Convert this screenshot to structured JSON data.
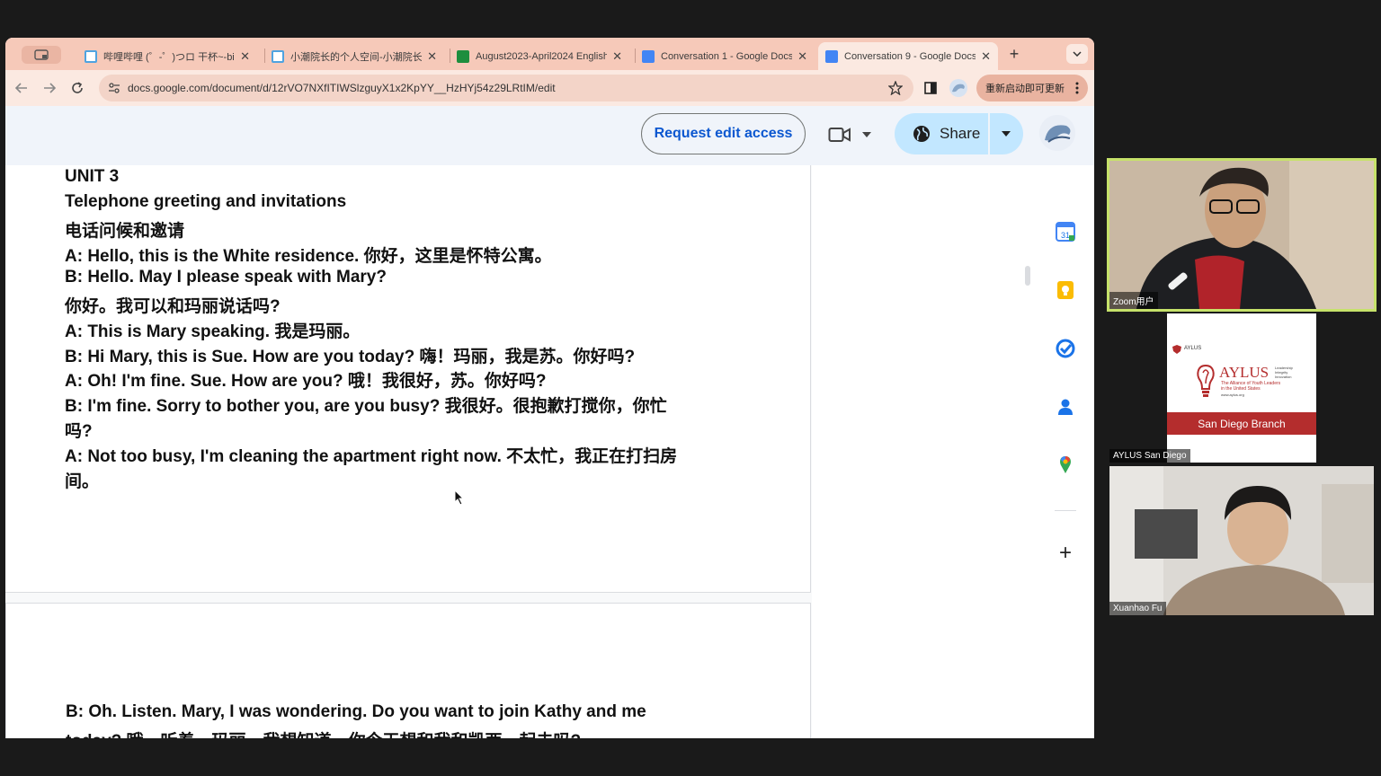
{
  "browser": {
    "tabs": [
      {
        "title": "哔哩哔哩 (゜-゜)つロ 干杯~-bi",
        "favicon_color": "#4fa3e0"
      },
      {
        "title": "小潮院长的个人空间-小潮院长",
        "favicon_color": "#4fa3e0"
      },
      {
        "title": "August2023-April2024 English",
        "favicon_color": "#1e8e3e"
      },
      {
        "title": "Conversation 1 - Google Docs",
        "favicon_color": "#4285f4"
      },
      {
        "title": "Conversation 9 - Google Docs",
        "favicon_color": "#4285f4"
      }
    ],
    "new_tab_symbol": "+",
    "close_symbol": "✕",
    "url": "docs.google.com/document/d/12rVO7NXfITIWSlzguyX1x2KpYY__HzHYj54z29LRtIM/edit",
    "relaunch_label": "重新启动即可更新"
  },
  "docs": {
    "request_edit_label": "Request edit access",
    "share_label": "Share",
    "page1_lines": [
      "UNIT 3",
      "Telephone greeting and invitations",
      "电话问候和邀请",
      "A: Hello, this is the White residence. 你好，这里是怀特公寓。",
      "B: Hello. May I please speak with Mary?",
      "你好。我可以和玛丽说话吗?",
      "A: This is Mary speaking. 我是玛丽。",
      "B: Hi Mary, this is Sue. How are you today? 嗨！玛丽，我是苏。你好吗?",
      "A: Oh! I'm fine. Sue. How are you? 哦！我很好，苏。你好吗?",
      "B: I'm fine. Sorry to bother you, are you busy? 我很好。很抱歉打搅你，你忙",
      "吗?",
      "A: Not too busy, I'm cleaning the apartment right now. 不太忙，我正在打扫房",
      "间。"
    ],
    "page2_lines": [
      "B: Oh. Listen. Mary, I was wondering. Do you want to join Kathy and me",
      "today? 哦，听着，玛丽，我想知道，你今天想和我和凯西一起去吗?"
    ],
    "side_icons": [
      "calendar-icon",
      "keep-icon",
      "tasks-icon",
      "contacts-icon",
      "maps-icon"
    ],
    "add_symbol": "+"
  },
  "zoom": {
    "participants": [
      {
        "name": "Zoom用户"
      },
      {
        "name": "AYLUS San Diego"
      },
      {
        "name": "Xuanhao Fu"
      }
    ],
    "aylus_logo": {
      "small_brand": "AYLUS",
      "brand": "AYLUS",
      "tagline_lines": [
        "Leadership",
        "Integrity",
        "Innovation"
      ],
      "subtitle_lines": [
        "The Alliance of Youth Leaders",
        "in the United States"
      ],
      "website": "www.aylus.org",
      "branch": "San Diego Branch"
    },
    "active_speaker_color": "#c6e26a"
  }
}
